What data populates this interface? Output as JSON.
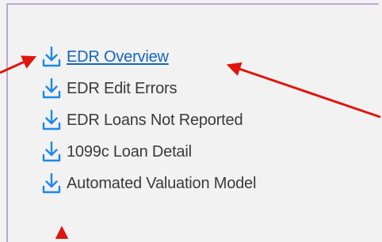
{
  "colors": {
    "panel_border": "#b9a8d6",
    "icon": "#1e88e5",
    "link_active": "#1565c0",
    "text": "#3a3a3a",
    "annotation_arrow": "#e0150e"
  },
  "reports": {
    "items": [
      {
        "label": "EDR Overview",
        "icon": "download-icon",
        "active": true
      },
      {
        "label": "EDR Edit Errors",
        "icon": "download-icon",
        "active": false
      },
      {
        "label": "EDR Loans Not Reported",
        "icon": "download-icon",
        "active": false
      },
      {
        "label": "1099c Loan Detail",
        "icon": "download-icon",
        "active": false
      },
      {
        "label": "Automated Valuation Model",
        "icon": "download-icon",
        "active": false
      }
    ]
  }
}
